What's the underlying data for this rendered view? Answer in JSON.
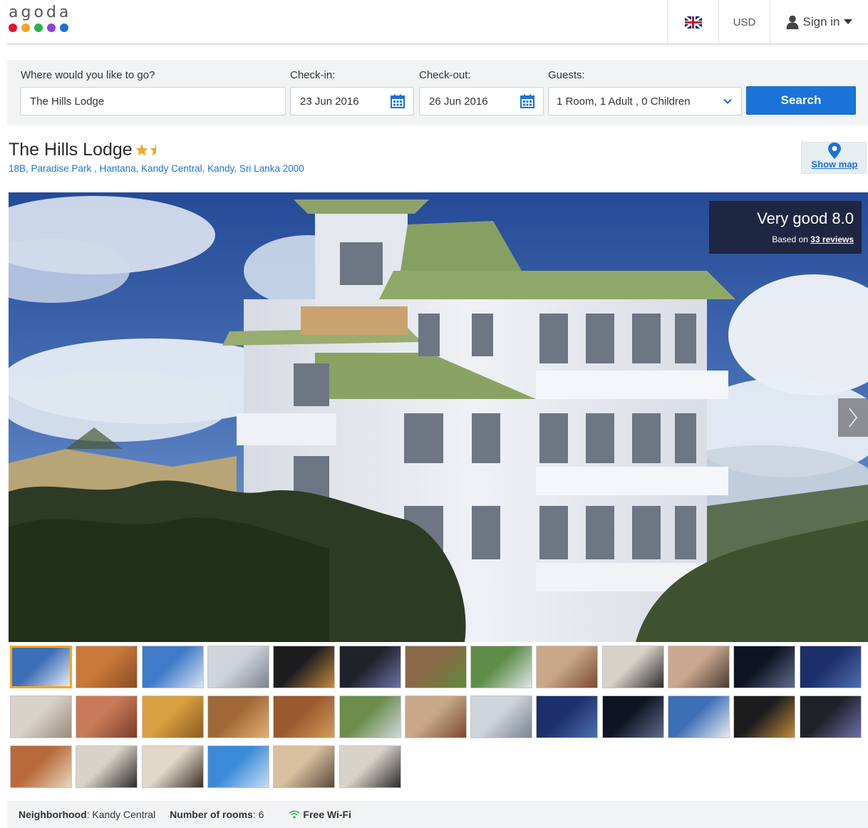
{
  "header": {
    "logo_text": "agoda",
    "logo_dot_colors": [
      "#e8102e",
      "#f5a623",
      "#2bb34a",
      "#8e3fd6",
      "#1a73d9"
    ],
    "language_icon": "uk-flag-icon",
    "currency": "USD",
    "signin_label": "Sign in"
  },
  "search": {
    "destination_label": "Where would you like to go?",
    "destination_value": "The Hills Lodge",
    "checkin_label": "Check-in:",
    "checkin_value": "23 Jun 2016",
    "checkout_label": "Check-out:",
    "checkout_value": "26 Jun 2016",
    "guests_label": "Guests:",
    "guests_value": "1 Room, 1 Adult , 0 Children",
    "search_button": "Search"
  },
  "hotel": {
    "name": "The Hills Lodge",
    "star_rating": 1.5,
    "address": "18B, Paradise Park , Hantana, Kandy Central, Kandy, Sri Lanka 2000",
    "map_label": "Show map"
  },
  "review": {
    "summary": "Very good 8.0",
    "based_on": "Based on",
    "reviews_link": "33 reviews"
  },
  "gallery": {
    "selected_index": 0,
    "thumbnail_count": 32
  },
  "facts": {
    "neighborhood_label": "Neighborhood",
    "neighborhood_value": ": Kandy Central",
    "rooms_label": "Number of rooms",
    "rooms_value": ": 6",
    "wifi_label": "Free Wi-Fi"
  },
  "colors": {
    "accent_blue": "#1a73d9",
    "star_orange": "#f5a623",
    "review_bg": "#1c243a"
  }
}
